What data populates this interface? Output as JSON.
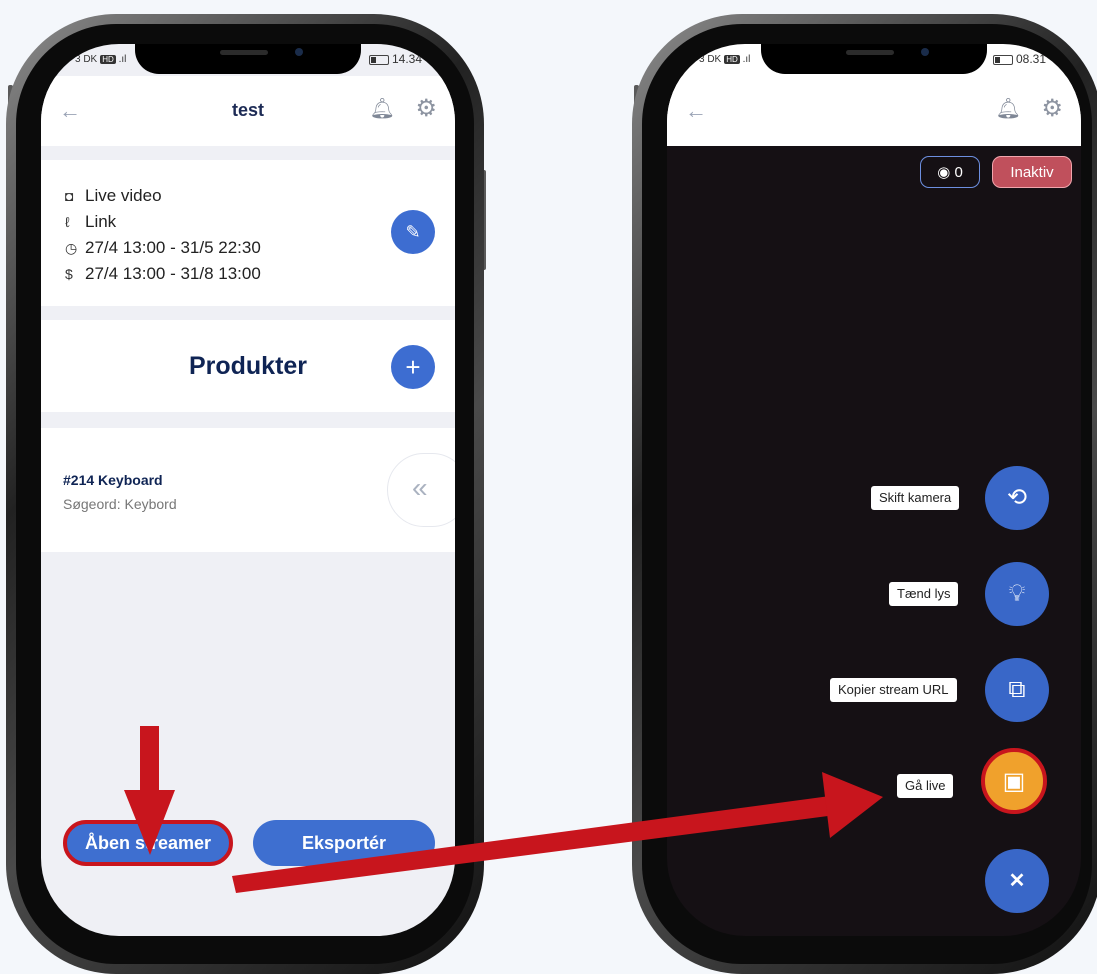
{
  "colors": {
    "brand_blue": "#3e6fd0",
    "navy_text": "#0f2454",
    "annotation_red": "#c8151d",
    "live_orange": "#f0a12c",
    "inactive_red": "#c0505c"
  },
  "left_phone": {
    "status": {
      "carrier": "3 DK",
      "hd": "HD",
      "time": "14.34"
    },
    "header": {
      "back_icon": "arrow-left-icon",
      "title": "test",
      "bell_icon": "bell-icon",
      "gear_icon": "gear-icon"
    },
    "event_card": {
      "rows": [
        {
          "icon": "video-icon",
          "text": "Live video"
        },
        {
          "icon": "link-icon",
          "text": "Link"
        },
        {
          "icon": "clock-icon",
          "text": "27/4 13:00 - 31/5 22:30"
        },
        {
          "icon": "money-hand-icon",
          "text": "27/4 13:00 - 31/8 13:00"
        }
      ],
      "edit_icon": "pencil-icon"
    },
    "products_section": {
      "title": "Produkter",
      "add_icon": "plus-icon"
    },
    "product": {
      "name": "#214 Keyboard",
      "subtitle": "Søgeord: Keybord",
      "swipe_icon": "double-chevron-left-icon"
    },
    "footer": {
      "open_streamer": "Åben streamer",
      "export": "Eksportér"
    }
  },
  "right_phone": {
    "status": {
      "carrier": "3 DK",
      "hd": "HD",
      "time": "08.31"
    },
    "header": {
      "back_icon": "arrow-left-icon",
      "bell_icon": "bell-icon",
      "gear_icon": "gear-icon"
    },
    "viewer_count": "0",
    "status_badge": "Inaktiv",
    "actions": [
      {
        "label": "Skift kamera",
        "icon": "camera-switch-icon"
      },
      {
        "label": "Tænd lys",
        "icon": "lightbulb-icon"
      },
      {
        "label": "Kopier stream URL",
        "icon": "copy-icon"
      },
      {
        "label": "Gå live",
        "icon": "play-icon"
      }
    ],
    "close_icon": "close-icon"
  }
}
